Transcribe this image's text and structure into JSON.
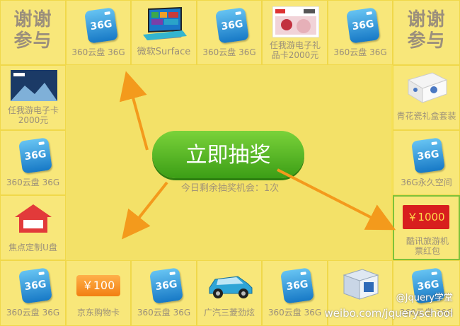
{
  "cells": {
    "c0": {
      "thanks": "谢谢参与"
    },
    "c1": {
      "badge": "36G",
      "label": "360云盘 36G"
    },
    "c2": {
      "label": "微软Surface"
    },
    "c3": {
      "badge": "36G",
      "label": "360云盘 36G"
    },
    "c4": {
      "label": "任我游电子礼品卡2000元"
    },
    "c5": {
      "badge": "36G",
      "label": "360云盘 36G"
    },
    "c6": {
      "thanks": "谢谢参与"
    },
    "c7": {
      "label": "青花瓷礼盒套装"
    },
    "c8": {
      "badge": "36G",
      "label": "36G永久空间"
    },
    "c9": {
      "amount": "￥1000",
      "label": "酷讯旅游机票红包"
    },
    "c10": {
      "badge": "36G",
      "label": "360云盘 36G"
    },
    "c11": {
      "label": ""
    },
    "c12": {
      "badge": "36G",
      "label": "广汽三菱劲炫"
    },
    "c13": {
      "badge": "36G",
      "label": "360云盘 36G"
    },
    "c14": {
      "amount": "￥100",
      "label": "京东购物卡"
    },
    "c15": {
      "badge": "36G",
      "label": "360云盘 36G"
    },
    "c16": {
      "label": "焦点定制U盘"
    },
    "c17": {
      "badge": "36G",
      "label": "360云盘 36G"
    },
    "c18": {
      "label": "任我游电子卡2000元"
    }
  },
  "center": {
    "draw_button": "立即抽奖",
    "remaining": "今日剩余抽奖机会：1次"
  },
  "watermark": {
    "weibo_name": "@Jquery学堂",
    "url": "weibo.com/jqueryschool"
  },
  "colors": {
    "board": "#f5e156",
    "button": "#4caf1f",
    "arrow": "#f39a1c",
    "highlight": "#7fc23a"
  }
}
